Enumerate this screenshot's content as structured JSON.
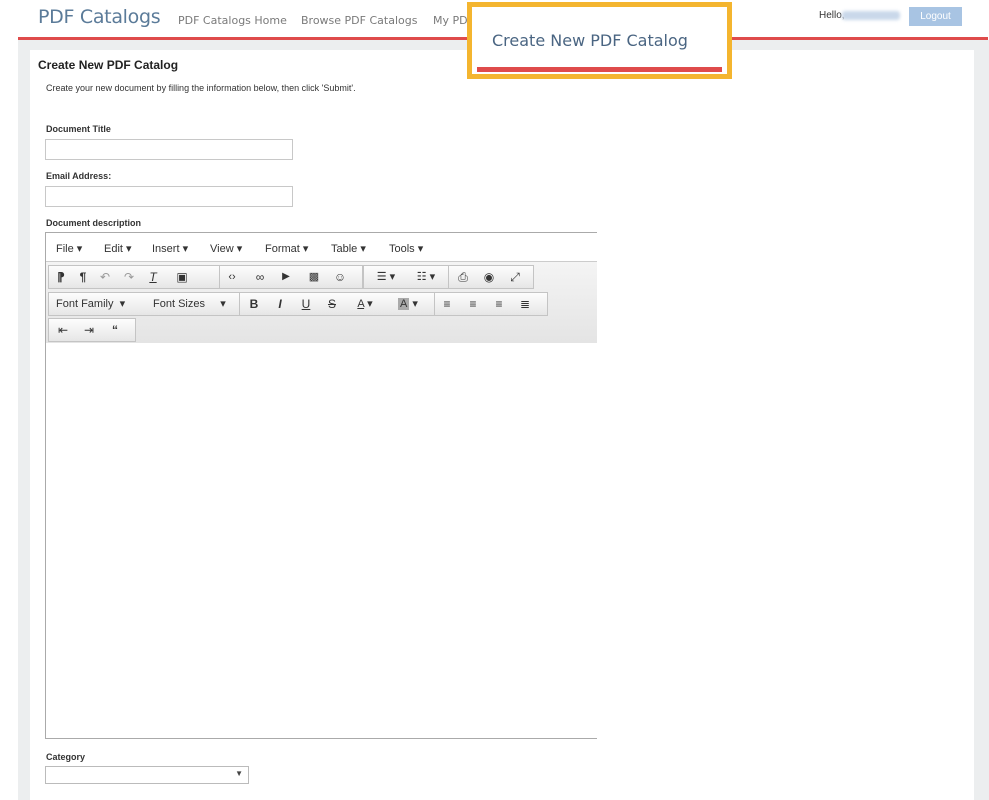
{
  "app": {
    "brand": "PDF Catalogs"
  },
  "nav": {
    "items": [
      "PDF Catalogs Home",
      "Browse PDF Catalogs",
      "My PDF"
    ]
  },
  "user": {
    "hello": "Hello,",
    "logout": "Logout"
  },
  "highlight": {
    "label": "Create New PDF Catalog"
  },
  "page": {
    "title": "Create New PDF Catalog",
    "intro": "Create your new document by filling the information below, then click 'Submit'."
  },
  "form": {
    "title_label": "Document Title",
    "title_value": "",
    "email_label": "Email Address:",
    "email_value": "",
    "description_label": "Document description",
    "category_label": "Category",
    "category_value": ""
  },
  "editor": {
    "menu": [
      "File",
      "Edit",
      "Insert",
      "View",
      "Format",
      "Table",
      "Tools"
    ],
    "font_family": "Font Family",
    "font_sizes": "Font Sizes"
  },
  "colors": {
    "accent_red": "#df4b4b",
    "highlight": "#f4b52f",
    "brand": "#5b7b99",
    "logout_bg": "#a8c4e3"
  }
}
